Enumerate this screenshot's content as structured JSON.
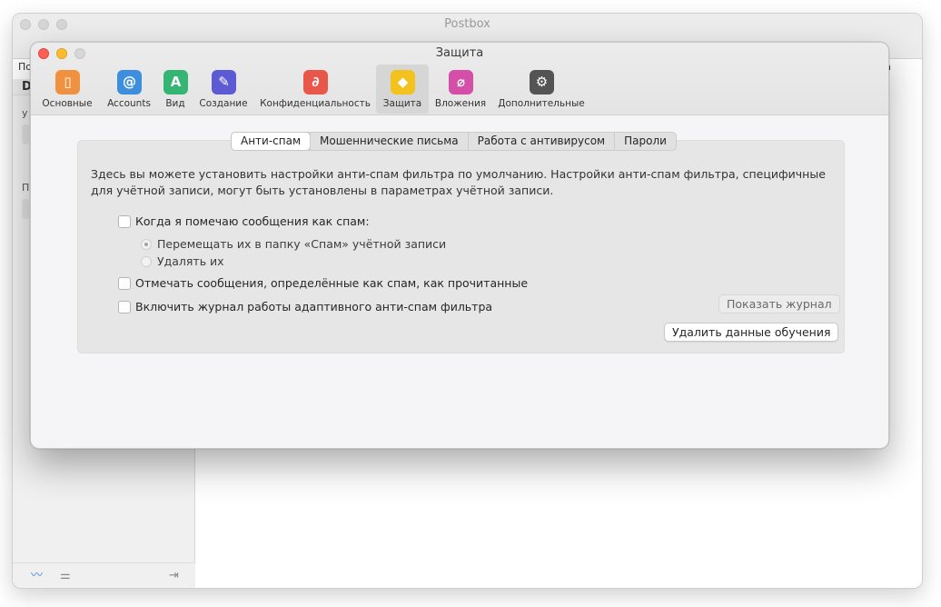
{
  "background_window": {
    "title": "Postbox",
    "toolbar_left_fragment": "По",
    "toolbar_right_fragment": "а",
    "sidebar_fragments": [
      "D",
      "у",
      "П"
    ]
  },
  "dialog": {
    "title": "Защита",
    "toolbar": [
      {
        "id": "general",
        "label": "Основные",
        "icon": "phone-icon",
        "color": "#f0913f",
        "glyph": "▯"
      },
      {
        "id": "accounts",
        "label": "Accounts",
        "icon": "at-icon",
        "color": "#3d8fde",
        "glyph": "@"
      },
      {
        "id": "view",
        "label": "Вид",
        "icon": "letter-a-icon",
        "color": "#35b573",
        "glyph": "A"
      },
      {
        "id": "compose",
        "label": "Создание",
        "icon": "pencil-icon",
        "color": "#5d5bd4",
        "glyph": "✎"
      },
      {
        "id": "privacy",
        "label": "Конфиденциальность",
        "icon": "privacy-icon",
        "color": "#e9574a",
        "glyph": "∂"
      },
      {
        "id": "security",
        "label": "Защита",
        "icon": "shield-icon",
        "color": "#f3c21e",
        "glyph": "◆"
      },
      {
        "id": "attachments",
        "label": "Вложения",
        "icon": "paperclip-icon",
        "color": "#d44fa7",
        "glyph": "⌀"
      },
      {
        "id": "advanced",
        "label": "Дополнительные",
        "icon": "gear-icon",
        "color": "#545454",
        "glyph": "⚙"
      }
    ],
    "active_toolbar": "security",
    "tabs": [
      {
        "label": "Анти-спам",
        "active": true
      },
      {
        "label": "Мошеннические письма",
        "active": false
      },
      {
        "label": "Работа с антивирусом",
        "active": false
      },
      {
        "label": "Пароли",
        "active": false
      }
    ],
    "description": "Здесь вы можете установить настройки анти-спам фильтра по умолчанию. Настройки анти-спам фильтра, специфичные для учётной записи, могут быть установлены в параметрах учётной записи.",
    "options": {
      "when_mark_spam": {
        "label": "Когда я помечаю сообщения как спам:",
        "checked": false
      },
      "move_to_spam": {
        "label": "Перемещать их в папку «Спам» учётной записи",
        "selected": true
      },
      "delete_them": {
        "label": "Удалять их",
        "selected": false
      },
      "mark_as_read": {
        "label": "Отмечать сообщения, определённые как спам, как прочитанные",
        "checked": false
      },
      "enable_log": {
        "label": "Включить журнал работы адаптивного анти-спам фильтра",
        "checked": false
      }
    },
    "buttons": {
      "show_log": "Показать журнал",
      "delete_training": "Удалить данные обучения"
    }
  }
}
